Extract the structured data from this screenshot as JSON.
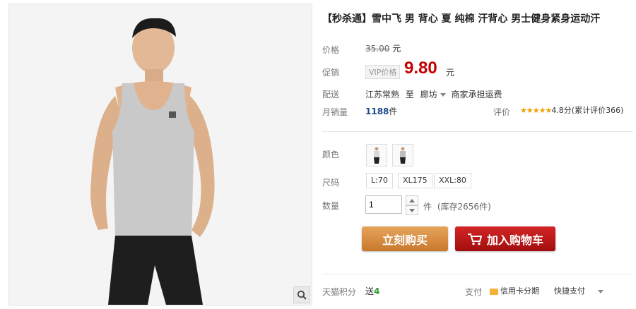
{
  "product": {
    "title": "【秒杀通】雪中飞 男 背心 夏 纯棉 汗背心 男士健身紧身运动汗"
  },
  "price": {
    "label": "价格",
    "original": "35.00",
    "unit": "元"
  },
  "promo": {
    "label": "促销",
    "vip_tag": "VIP价格",
    "value": "9.80",
    "unit": "元"
  },
  "delivery": {
    "label": "配送",
    "from": "江苏常熟",
    "to_word": "至",
    "destination": "廊坊",
    "note": "商家承担运费"
  },
  "sales": {
    "label": "月销量",
    "count": "1188",
    "unit": "件",
    "rating_label": "评价",
    "stars": "★★★★★",
    "rating_text": "4.8分(累计评价366)"
  },
  "color": {
    "label": "颜色"
  },
  "size": {
    "label": "尺码",
    "options": [
      "L:70",
      "XL175",
      "XXL:80"
    ]
  },
  "quantity": {
    "label": "数量",
    "value": "1",
    "unit": "件",
    "stock": "(库存2656件)"
  },
  "buttons": {
    "buy_now": "立刻购买",
    "add_cart": "加入购物车"
  },
  "footer": {
    "points_label": "天猫积分",
    "points_prefix": "送",
    "points_value": "4",
    "pay_label": "支付",
    "credit": "信用卡分期",
    "quick_pay": "快捷支付"
  },
  "colors": {
    "price_red": "#c40000",
    "buy_orange": "#d58a3c",
    "cart_red": "#c21a1a",
    "points_green": "#2a9a2a"
  }
}
